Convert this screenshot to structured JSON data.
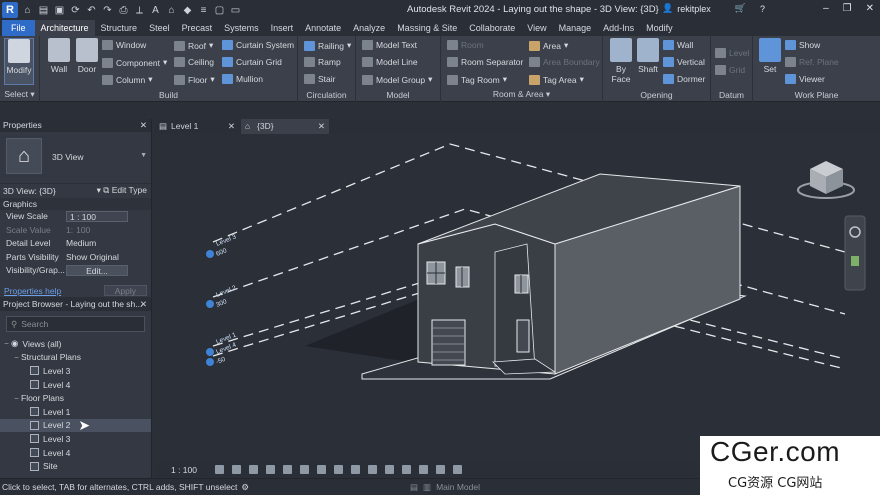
{
  "app": {
    "logo": "R",
    "title": "Autodesk Revit 2024 - Laying out the shape - 3D View: {3D}",
    "user": "rekitplex"
  },
  "tabs": [
    "File",
    "Architecture",
    "Structure",
    "Steel",
    "Precast",
    "Systems",
    "Insert",
    "Annotate",
    "Analyze",
    "Massing & Site",
    "Collaborate",
    "View",
    "Manage",
    "Add-Ins",
    "Modify"
  ],
  "ribbon": {
    "select": {
      "modify": "Modify",
      "label": "Select"
    },
    "build": {
      "label": "Build",
      "wall": "Wall",
      "door": "Door",
      "window": "Window",
      "component": "Component",
      "column": "Column",
      "roof": "Roof",
      "ceiling": "Ceiling",
      "floor": "Floor",
      "curtain_system": "Curtain System",
      "curtain_grid": "Curtain Grid",
      "mullion": "Mullion"
    },
    "circulation": {
      "label": "Circulation",
      "railing": "Railing",
      "ramp": "Ramp",
      "stair": "Stair"
    },
    "model": {
      "label": "Model",
      "model_text": "Model Text",
      "model_line": "Model Line",
      "model_group": "Model Group"
    },
    "room_area": {
      "label": "Room & Area",
      "room": "Room",
      "room_separator": "Room Separator",
      "tag_room": "Tag Room",
      "area": "Area",
      "area_boundary": "Area Boundary",
      "tag_area": "Tag Area"
    },
    "opening": {
      "label": "Opening",
      "by_face": "By Face",
      "shaft": "Shaft",
      "wall": "Wall",
      "vertical": "Vertical",
      "dormer": "Dormer"
    },
    "datum": {
      "label": "Datum",
      "level": "Level",
      "grid": "Grid"
    },
    "work_plane": {
      "label": "Work Plane",
      "set": "Set",
      "show": "Show",
      "ref_plane": "Ref. Plane",
      "viewer": "Viewer"
    }
  },
  "properties": {
    "header": "Properties",
    "type_name": "3D View",
    "instance": "3D View: {3D}",
    "edit_type": "Edit Type",
    "section": "Graphics",
    "rows": [
      {
        "k": "View Scale",
        "v": "1 : 100"
      },
      {
        "k": "Scale Value",
        "v": "1:",
        "v2": "100"
      },
      {
        "k": "Detail Level",
        "v": "Medium"
      },
      {
        "k": "Parts Visibility",
        "v": "Show Original"
      },
      {
        "k": "Visibility/Grap...",
        "v": "Edit..."
      }
    ],
    "help": "Properties help",
    "apply": "Apply"
  },
  "browser": {
    "header": "Project Browser - Laying out the sh...",
    "search_placeholder": "Search",
    "views_all": "Views (all)",
    "structural_plans": "Structural Plans",
    "sp_items": [
      "Level 3",
      "Level 4"
    ],
    "floor_plans": "Floor Plans",
    "fp_items": [
      "Level 1",
      "Level 2",
      "Level 3",
      "Level 4",
      "Site"
    ]
  },
  "view_tabs": [
    {
      "label": "Level 1"
    },
    {
      "label": "{3D}"
    }
  ],
  "levels": [
    {
      "name": "Level 3",
      "elev": "600"
    },
    {
      "name": "Level 2",
      "elev": "300"
    },
    {
      "name": "Level 1",
      "elev": ""
    },
    {
      "name": "Level 4",
      "elev": "-50"
    }
  ],
  "view_bar": {
    "scale": "1 : 100"
  },
  "status": {
    "message": "Click to select, TAB for alternates, CTRL adds, SHIFT unselect",
    "model": "Main Model"
  },
  "watermark": {
    "line1": "CGer.com",
    "line2": "CG资源 CG网站"
  },
  "colors": {
    "accent": "#2f6cc7",
    "panel": "#3b404b",
    "canvas": "#2b2f38"
  }
}
